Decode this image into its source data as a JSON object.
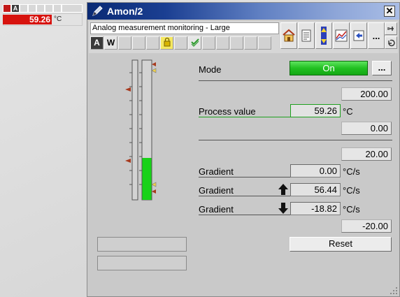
{
  "mini": {
    "status_badge": "A",
    "value": "59.26",
    "unit": "°C"
  },
  "window": {
    "title": "Amon/2",
    "close_glyph": "✕"
  },
  "toolbar": {
    "description": "Analog measurement monitoring - Large",
    "status_auto": "A",
    "status_w": "W",
    "more_label": "..."
  },
  "mode": {
    "label": "Mode",
    "value": "On",
    "more_label": "..."
  },
  "process": {
    "high_limit": "200.00",
    "label": "Process value",
    "value": "59.26",
    "unit": "°C",
    "low_limit": "0.00"
  },
  "gradient": {
    "upper_limit": "20.00",
    "rows": [
      {
        "label": "Gradient",
        "direction": "none",
        "value": "0.00",
        "unit": "°C/s"
      },
      {
        "label": "Gradient",
        "direction": "up",
        "value": "56.44",
        "unit": "°C/s"
      },
      {
        "label": "Gradient",
        "direction": "down",
        "value": "-18.82",
        "unit": "°C/s"
      }
    ],
    "lower_limit": "-20.00"
  },
  "reset_label": "Reset",
  "bar": {
    "process_fill_fraction": 0.3,
    "gradient_fill_fraction": 0.0
  },
  "colors": {
    "on_green": "#21c021",
    "bar_green": "#19d219",
    "alarm_red": "#d7130e",
    "limit_marker": "#a83a1e"
  }
}
